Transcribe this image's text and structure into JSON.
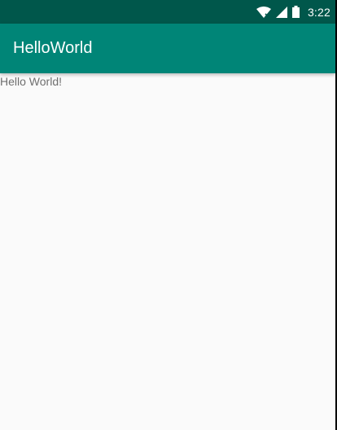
{
  "status_bar": {
    "time": "3:22",
    "icons": [
      "wifi-icon",
      "signal-icon",
      "battery-icon"
    ]
  },
  "app_bar": {
    "title": "HelloWorld"
  },
  "main": {
    "text": "Hello World!"
  },
  "colors": {
    "status_bar": "#00574b",
    "app_bar": "#008577",
    "background": "#fafafa",
    "text": "#6f6f6f"
  }
}
